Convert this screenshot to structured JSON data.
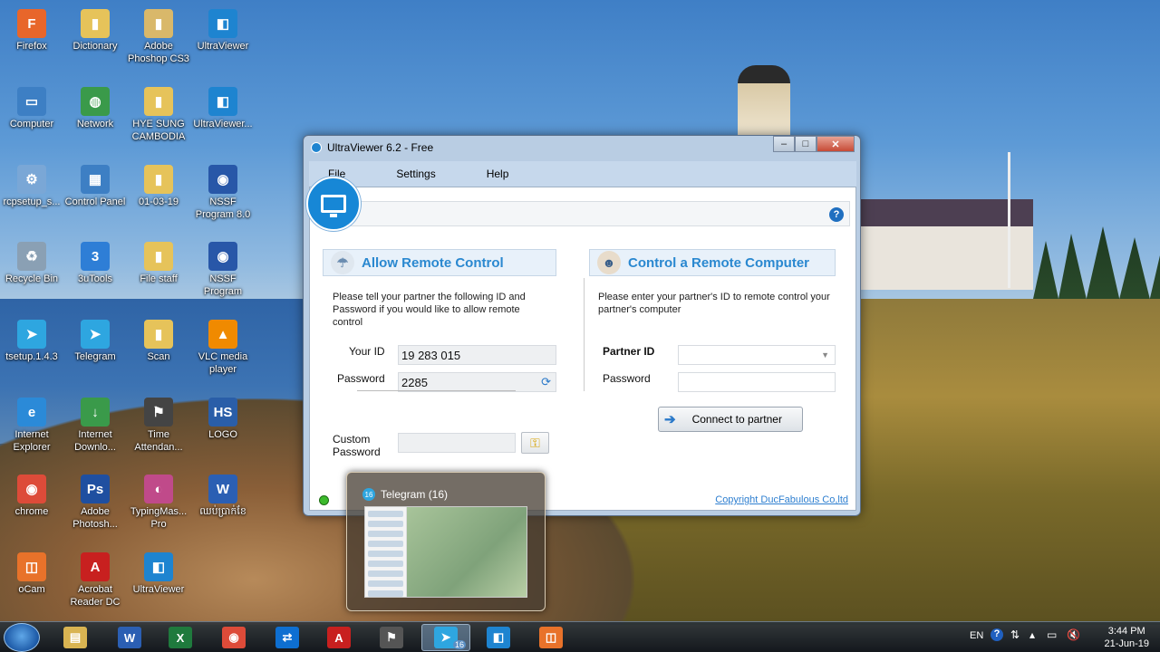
{
  "desktop": {
    "icons": [
      {
        "label": "Firefox",
        "color": "#e8662a",
        "glyph": "F"
      },
      {
        "label": "Dictionary",
        "color": "#e6c35a",
        "glyph": "▮"
      },
      {
        "label": "Adobe Phoshop CS3",
        "color": "#d9b86a",
        "glyph": "▮"
      },
      {
        "label": "UltraViewer",
        "color": "#1e84d0",
        "glyph": "◧"
      },
      {
        "label": "Computer",
        "color": "#3d7fc4",
        "glyph": "▭"
      },
      {
        "label": "Network",
        "color": "#3a9a4a",
        "glyph": "◍"
      },
      {
        "label": "HYE SUNG CAMBODIA",
        "color": "#e6c35a",
        "glyph": "▮"
      },
      {
        "label": "UltraViewer...",
        "color": "#1e84d0",
        "glyph": "◧"
      },
      {
        "label": "rcpsetup_s...",
        "color": "#7aa7d6",
        "glyph": "⚙"
      },
      {
        "label": "Control Panel",
        "color": "#3d7fc4",
        "glyph": "▦"
      },
      {
        "label": "01-03-19",
        "color": "#e6c35a",
        "glyph": "▮"
      },
      {
        "label": "NSSF Program 8.0",
        "color": "#2857a8",
        "glyph": "◉"
      },
      {
        "label": "Recycle Bin",
        "color": "#8aa0b4",
        "glyph": "♻"
      },
      {
        "label": "3uTools",
        "color": "#2e7ed6",
        "glyph": "3"
      },
      {
        "label": "File staff",
        "color": "#e6c35a",
        "glyph": "▮"
      },
      {
        "label": "NSSF Program",
        "color": "#2857a8",
        "glyph": "◉"
      },
      {
        "label": "tsetup.1.4.3",
        "color": "#2ea6e0",
        "glyph": "➤"
      },
      {
        "label": "Telegram",
        "color": "#2ea6e0",
        "glyph": "➤"
      },
      {
        "label": "Scan",
        "color": "#e6c35a",
        "glyph": "▮"
      },
      {
        "label": "VLC media player",
        "color": "#f08a00",
        "glyph": "▲"
      },
      {
        "label": "Internet Explorer",
        "color": "#2b8ad8",
        "glyph": "e"
      },
      {
        "label": "Internet Downlo...",
        "color": "#3a9a4a",
        "glyph": "↓"
      },
      {
        "label": "Time Attendan...",
        "color": "#444444",
        "glyph": "⚑"
      },
      {
        "label": "LOGO",
        "color": "#2a5ea8",
        "glyph": "HS"
      },
      {
        "label": "chrome",
        "color": "#dd4b39",
        "glyph": "◉"
      },
      {
        "label": "Adobe Photosh...",
        "color": "#1f4fa0",
        "glyph": "Ps"
      },
      {
        "label": "TypingMas... Pro",
        "color": "#c04a8a",
        "glyph": "◐"
      },
      {
        "label": "ឈប់ប្រាក់ខែ",
        "color": "#2b5fb3",
        "glyph": "W"
      },
      {
        "label": "oCam",
        "color": "#e8722a",
        "glyph": "◫"
      },
      {
        "label": "Acrobat Reader DC",
        "color": "#c8201f",
        "glyph": "A"
      },
      {
        "label": "UltraViewer",
        "color": "#1e84d0",
        "glyph": "◧"
      }
    ]
  },
  "window": {
    "title": "UltraViewer 6.2 - Free",
    "minimize": "–",
    "maximize": "□",
    "close": "✕",
    "menu": [
      "File",
      "Settings",
      "Help"
    ],
    "help_glyph": "?",
    "allow": {
      "heading": "Allow Remote Control",
      "description": "Please tell your partner the following ID and Password if you would like to allow remote control",
      "your_id_label": "Your ID",
      "your_id_value": "19 283 015",
      "password_label": "Password",
      "password_value": "2285",
      "custom_password_label": "Custom Password",
      "custom_password_value": ""
    },
    "control": {
      "heading": "Control a Remote Computer",
      "description": "Please enter your partner's ID to remote control your partner's computer",
      "partner_id_label": "Partner ID",
      "partner_id_value": "",
      "password_label": "Password",
      "password_value": "",
      "connect_button": "Connect to partner"
    },
    "copyright": "Copyright DucFabulous Co,ltd",
    "status_color": "#3cba2c"
  },
  "preview": {
    "title": "Telegram (16)",
    "badge": "16"
  },
  "taskbar": {
    "apps": [
      {
        "name": "explorer",
        "glyph": "▤",
        "color": "#d9b452"
      },
      {
        "name": "word",
        "glyph": "W",
        "color": "#2b5fb3"
      },
      {
        "name": "excel",
        "glyph": "X",
        "color": "#1f7a3d"
      },
      {
        "name": "chrome",
        "glyph": "◉",
        "color": "#dd4b39"
      },
      {
        "name": "teamviewer",
        "glyph": "⇄",
        "color": "#0e6fd1"
      },
      {
        "name": "acrobat",
        "glyph": "A",
        "color": "#c8201f"
      },
      {
        "name": "time-attendance",
        "glyph": "⚑",
        "color": "#555555"
      },
      {
        "name": "telegram",
        "glyph": "➤",
        "color": "#2ea6e0",
        "badge": "16"
      },
      {
        "name": "ultraviewer",
        "glyph": "◧",
        "color": "#1e84d0"
      },
      {
        "name": "ocam",
        "glyph": "◫",
        "color": "#e8722a"
      }
    ],
    "language": "EN",
    "time": "3:44 PM",
    "date": "21-Jun-19"
  }
}
